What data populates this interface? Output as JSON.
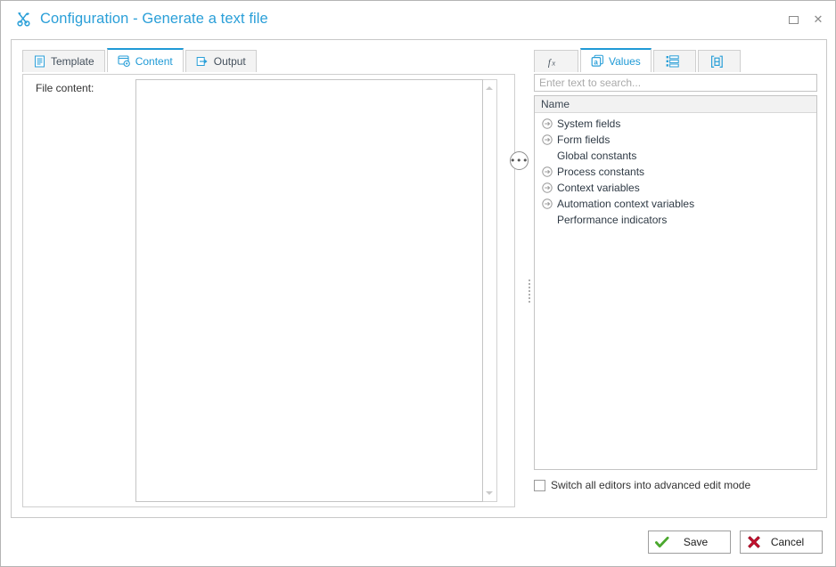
{
  "window": {
    "title": "Configuration - Generate a text file",
    "title_icon": "tools-icon",
    "accent_color": "#2a9fd8",
    "controls": {
      "restore_label": "",
      "close_label": "✕"
    }
  },
  "left_tabs": [
    {
      "label": "Template",
      "icon": "document-lines-icon",
      "active": false
    },
    {
      "label": "Content",
      "icon": "content-gear-icon",
      "active": true
    },
    {
      "label": "Output",
      "icon": "output-arrow-icon",
      "active": false
    }
  ],
  "left_pane": {
    "field_label": "File content:",
    "editor_value": "",
    "editor_placeholder": "",
    "more_button_label": "•••",
    "scrollbar": {
      "up_arrow": "scroll-up-arrow",
      "down_arrow": "scroll-down-arrow"
    }
  },
  "right_tabs": [
    {
      "label": "",
      "icon": "function-fx-icon",
      "active": false
    },
    {
      "label": "Values",
      "icon": "values-a-icon",
      "active": true
    },
    {
      "label": "",
      "icon": "list-details-icon",
      "active": false
    },
    {
      "label": "",
      "icon": "bracket-box-icon",
      "active": false
    }
  ],
  "right_pane": {
    "search": {
      "value": "",
      "placeholder": "Enter text to search..."
    },
    "tree": {
      "column_header": "Name",
      "rows": [
        {
          "label": "System fields",
          "expandable": true
        },
        {
          "label": "Form fields",
          "expandable": true
        },
        {
          "label": "Global constants",
          "expandable": false
        },
        {
          "label": "Process constants",
          "expandable": true
        },
        {
          "label": "Context variables",
          "expandable": true
        },
        {
          "label": "Automation context variables",
          "expandable": true
        },
        {
          "label": "Performance indicators",
          "expandable": false
        }
      ]
    },
    "advanced_checkbox": {
      "label": "Switch all editors into advanced edit mode",
      "checked": false
    }
  },
  "footer": {
    "save_label": "Save",
    "cancel_label": "Cancel",
    "save_icon": "green-check-icon",
    "cancel_icon": "red-x-icon",
    "save_color": "#4ba82e",
    "cancel_color": "#c8102e"
  }
}
